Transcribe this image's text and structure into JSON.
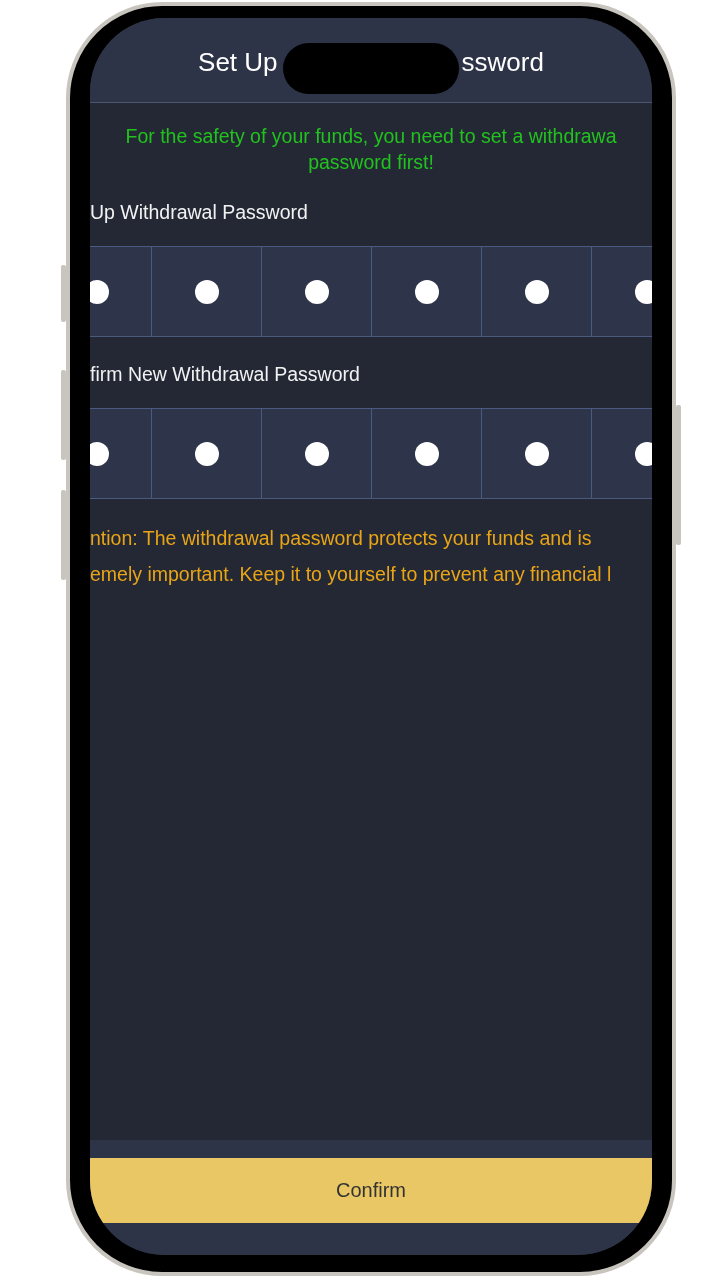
{
  "header": {
    "title_parts": [
      "Set Up",
      "ssword"
    ]
  },
  "notice": {
    "lines": [
      "For the safety of your funds, you need to set a withdrawa",
      "password first!"
    ]
  },
  "password_fields": [
    {
      "label": "Up Withdrawal Password",
      "cells": [
        {
          "filled": true
        },
        {
          "filled": true
        },
        {
          "filled": true
        },
        {
          "filled": true
        },
        {
          "filled": true
        },
        {
          "filled": true
        }
      ]
    },
    {
      "label": "firm New Withdrawal Password",
      "cells": [
        {
          "filled": true
        },
        {
          "filled": true
        },
        {
          "filled": true
        },
        {
          "filled": true
        },
        {
          "filled": true
        },
        {
          "filled": true
        }
      ]
    }
  ],
  "warning": {
    "lines": [
      "ntion: The withdrawal password protects your funds and is",
      "emely important. Keep it to yourself to prevent any financial l"
    ]
  },
  "confirm_button": {
    "label": "Confirm"
  }
}
